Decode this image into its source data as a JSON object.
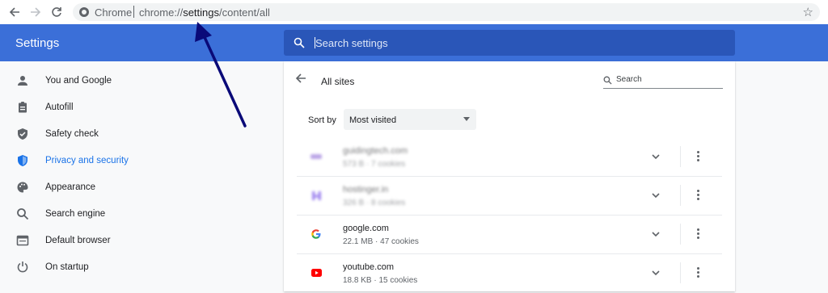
{
  "browser": {
    "nav_icons": [
      "back-arrow-icon",
      "forward-arrow-icon",
      "reload-icon",
      "bookmark-star-icon"
    ],
    "chip": "Chrome",
    "url_prefix": "chrome://",
    "url_host": "settings",
    "url_path": "/content/all"
  },
  "header": {
    "title": "Settings",
    "search_placeholder": "Search settings"
  },
  "sidebar": {
    "items": [
      {
        "label": "You and Google",
        "icon": "person-icon"
      },
      {
        "label": "Autofill",
        "icon": "clipboard-icon"
      },
      {
        "label": "Safety check",
        "icon": "shield-check-icon"
      },
      {
        "label": "Privacy and security",
        "icon": "shield-icon",
        "active": true
      },
      {
        "label": "Appearance",
        "icon": "palette-icon"
      },
      {
        "label": "Search engine",
        "icon": "search-icon"
      },
      {
        "label": "Default browser",
        "icon": "browser-window-icon"
      },
      {
        "label": "On startup",
        "icon": "power-icon"
      }
    ]
  },
  "main": {
    "title": "All sites",
    "search_placeholder": "Search",
    "sort_label": "Sort by",
    "sort_value": "Most visited",
    "sites": [
      {
        "name": "guidingtech.com",
        "meta": "573 B · 7 cookies",
        "blurred": true
      },
      {
        "name": "hostinger.in",
        "meta": "326 B · 8 cookies",
        "blurred": true
      },
      {
        "name": "google.com",
        "meta": "22.1 MB · 47 cookies",
        "blurred": false
      },
      {
        "name": "youtube.com",
        "meta": "18.8 KB · 15 cookies",
        "blurred": false
      }
    ]
  },
  "colors": {
    "header_blue": "#3b6fd8",
    "search_blue": "#2a56b8",
    "active_blue": "#1a73e8",
    "annotation_arrow": "#0a0a78"
  }
}
